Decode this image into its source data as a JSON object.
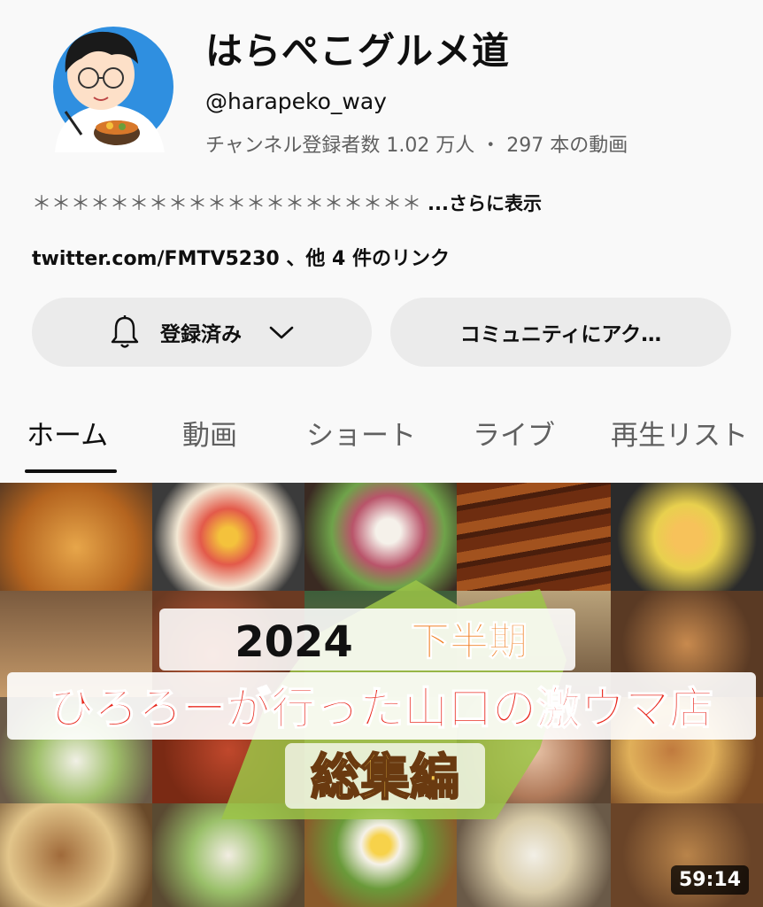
{
  "channel": {
    "name": "はらぺこグルメ道",
    "handle": "@harapeko_way",
    "stats": "チャンネル登録者数 1.02 万人 ・ 297 本の動画",
    "description": "＊＊＊＊＊＊＊＊＊＊＊＊＊＊＊＊＊＊＊＊",
    "description_more": "...さらに表示",
    "links": "twitter.com/FMTV5230 、他 4 件のリンク"
  },
  "buttons": {
    "subscribed": "登録済み",
    "community": "コミュニティにアク…"
  },
  "tabs": [
    "ホーム",
    "動画",
    "ショート",
    "ライブ",
    "再生リスト"
  ],
  "active_tab": "ホーム",
  "video": {
    "title_line1_a": "2024",
    "title_line1_b": "下半期",
    "title_line2": "ひろろーが行った山口の激ウマ店",
    "title_line3": "総集編",
    "duration": "59:14"
  },
  "colors": {
    "title_red": "#e8271c",
    "title_orange": "#f07a1a",
    "avatar_blue": "#2f8fe0",
    "map_green": "#9cc448"
  },
  "icons": {
    "bell": "bell-icon",
    "chevron": "chevron-down-icon"
  }
}
